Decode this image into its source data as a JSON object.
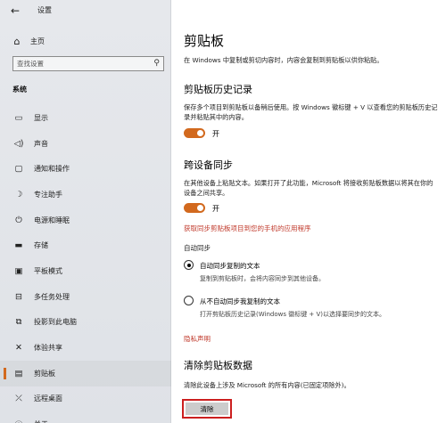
{
  "window": {
    "title": "设置",
    "back_icon": "arrow-left-icon"
  },
  "sidebar": {
    "home": {
      "label": "主页",
      "icon": "home-icon"
    },
    "search": {
      "placeholder": "查找设置",
      "icon": "search-icon"
    },
    "section": "系统",
    "items": [
      {
        "label": "显示",
        "icon": "display-icon"
      },
      {
        "label": "声音",
        "icon": "speaker-icon"
      },
      {
        "label": "通知和操作",
        "icon": "notification-icon"
      },
      {
        "label": "专注助手",
        "icon": "moon-icon"
      },
      {
        "label": "电源和睡眠",
        "icon": "power-icon"
      },
      {
        "label": "存储",
        "icon": "storage-icon"
      },
      {
        "label": "平板模式",
        "icon": "tablet-icon"
      },
      {
        "label": "多任务处理",
        "icon": "multitask-icon"
      },
      {
        "label": "投影到此电脑",
        "icon": "project-icon"
      },
      {
        "label": "体验共享",
        "icon": "share-icon"
      },
      {
        "label": "剪贴板",
        "icon": "clipboard-icon",
        "active": true
      },
      {
        "label": "远程桌面",
        "icon": "remote-icon"
      },
      {
        "label": "关于",
        "icon": "info-icon"
      }
    ]
  },
  "main": {
    "title": "剪贴板",
    "intro": "在 Windows 中复制或剪切内容时，内容会复制到剪贴板以供你粘贴。",
    "history": {
      "heading": "剪贴板历史记录",
      "desc": "保存多个项目到剪贴板以备稍后使用。按 Windows 徽标键 + V 以查看您的剪贴板历史记录并粘贴其中的内容。",
      "toggle_label": "开"
    },
    "sync": {
      "heading": "跨设备同步",
      "desc": "在其他设备上粘贴文本。如果打开了此功能，Microsoft 将接收剪贴板数据以将其在你的设备之间共享。",
      "toggle_label": "开",
      "link": "获取同步剪贴板项目到您的手机的应用程序",
      "auto_sync_label": "自动同步",
      "option1": {
        "label": "自动同步复制的文本",
        "desc": "复制到剪贴板时，会将内容同步到其他设备。"
      },
      "option2": {
        "label": "从不自动同步我复制的文本",
        "desc": "打开剪贴板历史记录(Windows 徽标键 + V)以选择要同步的文本。"
      }
    },
    "privacy_link": "隐私声明",
    "clear": {
      "heading": "清除剪贴板数据",
      "desc": "清除此设备上涉及 Microsoft 的所有内容(已固定项除外)。",
      "button": "清除"
    }
  },
  "colors": {
    "accent": "#d2691e",
    "link": "#c0392b",
    "highlight_border": "#cc1f1f"
  }
}
